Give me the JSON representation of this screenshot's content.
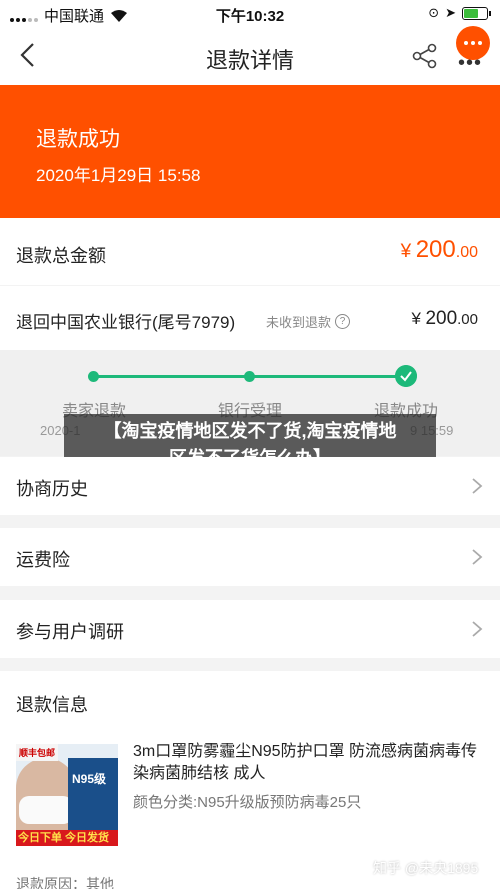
{
  "status_bar": {
    "carrier": "中国联通",
    "time": "下午10:32"
  },
  "nav": {
    "title": "退款详情"
  },
  "hero": {
    "status": "退款成功",
    "date": "2020年1月29日 15:58"
  },
  "refund_total": {
    "label": "退款总金额",
    "currency": "¥",
    "integer": "200",
    "decimal": ".00"
  },
  "refund_bank": {
    "label": "退回中国农业银行(尾号7979)",
    "note": "未收到退款",
    "currency": "¥",
    "integer": "200",
    "decimal": ".00"
  },
  "progress": {
    "steps": [
      {
        "label": "卖家退款",
        "date": "2020-1"
      },
      {
        "label": "银行受理",
        "date": ""
      },
      {
        "label": "退款成功",
        "date": "9 15:59"
      }
    ]
  },
  "overlay": {
    "line1": "【淘宝疫情地区发不了货,淘宝疫情地",
    "line2": "区发不了货怎么办】"
  },
  "menu": {
    "history": "协商历史",
    "shipping_insurance": "运费险",
    "research": "参与用户调研"
  },
  "refund_info": {
    "heading": "退款信息",
    "product": {
      "title": "3m口罩防雾霾尘N95防护口罩 防流感病菌病毒传染病菌肺结核 成人",
      "spec": "颜色分类:N95升级版预防病毒25只",
      "image_text": {
        "badge_top": "顺丰包邮",
        "box_label": "N95级",
        "badge_bottom": "今日下单 今日发货"
      }
    },
    "reason": "退款原因：其他"
  },
  "watermark": "知乎 @未央1895",
  "colors": {
    "accent": "#ff5000",
    "progress": "#1db97a"
  }
}
